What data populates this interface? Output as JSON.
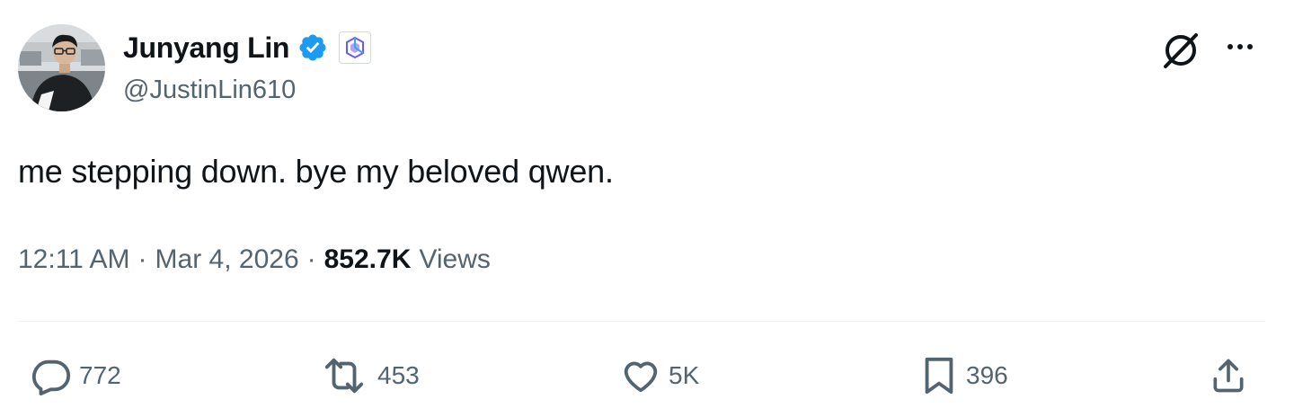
{
  "author": {
    "display_name": "Junyang Lin",
    "handle": "@JustinLin610",
    "verified": true,
    "verified_color": "#1d9bf0",
    "affiliation_badge": "qwen-logo-icon"
  },
  "tweet": {
    "text": "me stepping down. bye my beloved qwen."
  },
  "meta": {
    "time": "12:11 AM",
    "separator": "·",
    "date": "Mar 4, 2026",
    "views_count": "852.7K",
    "views_label": "Views"
  },
  "header_actions": {
    "grok_icon": "grok-icon",
    "more_icon": "more-icon"
  },
  "actions": {
    "reply_count": "772",
    "retweet_count": "453",
    "like_count": "5K",
    "bookmark_count": "396"
  },
  "colors": {
    "text_primary": "#0f1419",
    "text_secondary": "#536471",
    "divider": "#eff3f4",
    "accent": "#1d9bf0"
  }
}
